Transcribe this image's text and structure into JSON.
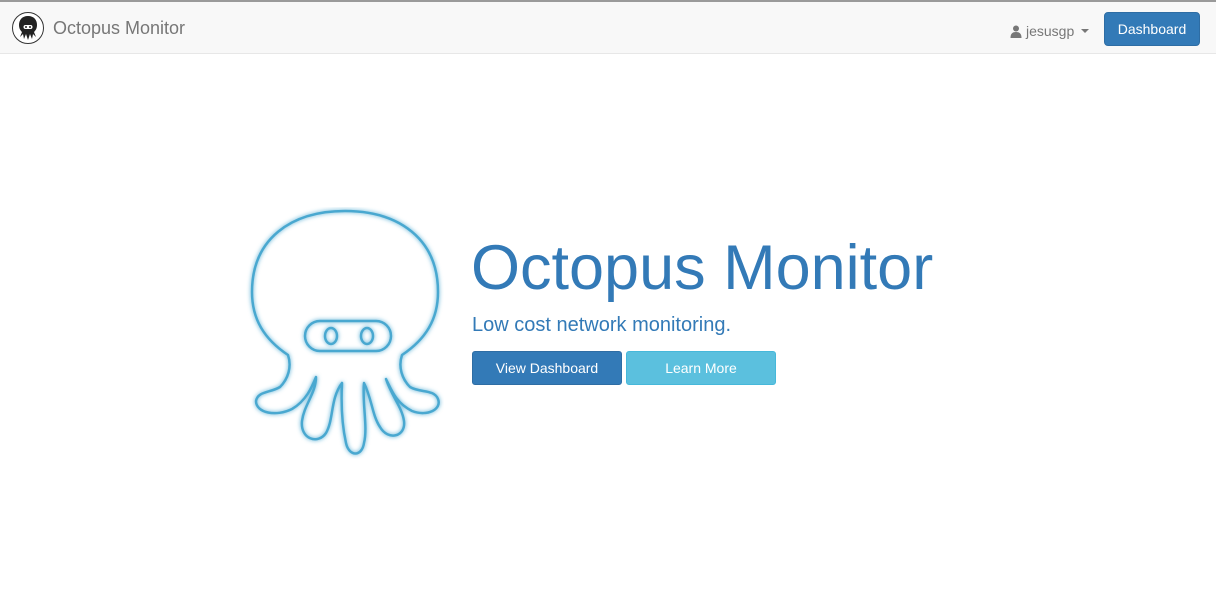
{
  "navbar": {
    "brand": "Octopus Monitor",
    "brand_logo_icon": "octopus-logo-icon",
    "user": {
      "name": "jesusgp",
      "icon": "user-icon"
    },
    "dashboard_button": "Dashboard"
  },
  "hero": {
    "logo_icon": "octopus-icon",
    "title": "Octopus Monitor",
    "subtitle": "Low cost network monitoring.",
    "buttons": {
      "view_dashboard": "View Dashboard",
      "learn_more": "Learn More"
    }
  },
  "colors": {
    "primary": "#337ab7",
    "info": "#5bc0de",
    "navbar_bg": "#f8f8f8",
    "navbar_text": "#777777",
    "logo_stroke": "#4aa8d0"
  }
}
